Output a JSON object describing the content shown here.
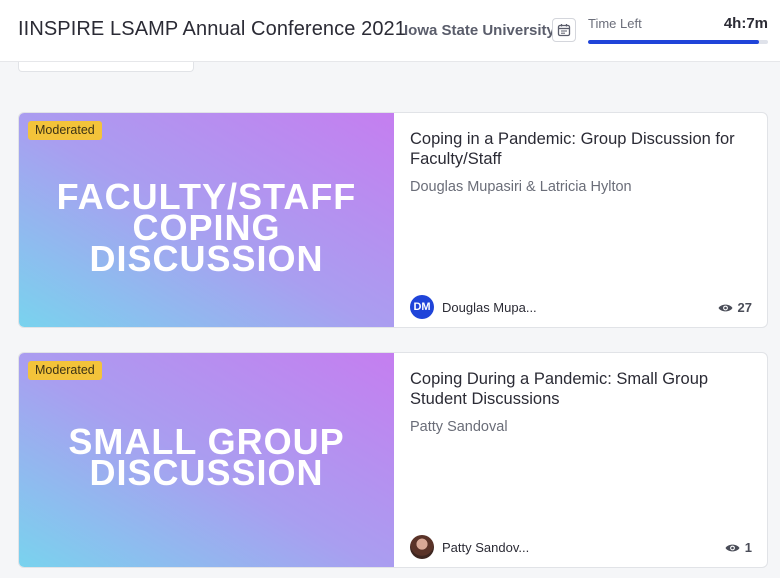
{
  "header": {
    "title": "IINSPIRE LSAMP Annual Conference 2021",
    "organization": "Iowa State University",
    "calendar_icon": "calendar-icon",
    "time_left_label": "Time Left",
    "time_left_value": "4h:7m",
    "time_left_progress": 0.95,
    "accent_color": "#1f44d9"
  },
  "sessions": [
    {
      "badge": "Moderated",
      "thumbnail_lines": [
        "FACULTY/STAFF",
        "COPING",
        "DISCUSSION"
      ],
      "title": "Coping in a Pandemic: Group Discussion for Faculty/Staff",
      "speakers": "Douglas Mupasiri & Latricia Hylton",
      "host_initials": "DM",
      "host_name": "Douglas Mupa...",
      "views": "27",
      "views_icon": "eye-icon"
    },
    {
      "badge": "Moderated",
      "thumbnail_lines": [
        "SMALL GROUP",
        "DISCUSSION"
      ],
      "title": "Coping During a Pandemic: Small Group Student Discussions",
      "speakers": "Patty Sandoval",
      "host_initials": "",
      "host_name": "Patty Sandov...",
      "views": "1",
      "views_icon": "eye-icon"
    }
  ],
  "colors": {
    "badge": "#f3c33a",
    "gradient_start": "#79d3ee",
    "gradient_end": "#c57ef0"
  }
}
